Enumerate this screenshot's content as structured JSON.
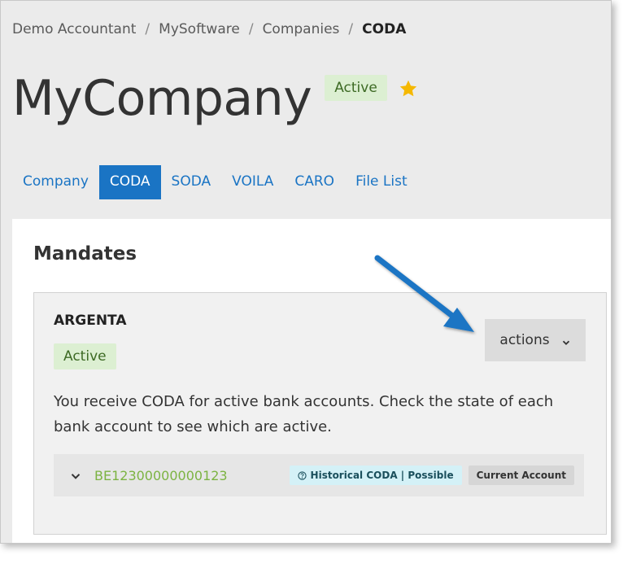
{
  "breadcrumb": {
    "items": [
      "Demo Accountant",
      "MySoftware",
      "Companies"
    ],
    "current": "CODA",
    "separator": "/"
  },
  "page": {
    "title": "MyCompany",
    "status": "Active",
    "favorite_icon": "star-icon"
  },
  "tabs": [
    {
      "label": "Company",
      "active": false
    },
    {
      "label": "CODA",
      "active": true
    },
    {
      "label": "SODA",
      "active": false
    },
    {
      "label": "VOILA",
      "active": false
    },
    {
      "label": "CARO",
      "active": false
    },
    {
      "label": "File List",
      "active": false
    }
  ],
  "mandates": {
    "title": "Mandates",
    "card": {
      "bank_name": "ARGENTA",
      "status": "Active",
      "actions_label": "actions",
      "description": "You receive CODA for active bank accounts. Check the state of each bank account to see which are active.",
      "account": {
        "iban": "BE12300000000123",
        "historical_tag": "Historical CODA | Possible",
        "account_type": "Current Account"
      }
    }
  },
  "colors": {
    "primary": "#1a74c4",
    "active_badge_bg": "#dcefd2",
    "active_badge_text": "#3d6a24",
    "iban_text": "#7cb342",
    "historical_tag_bg": "#d4f1f7",
    "star": "#f5b800",
    "annotation_arrow": "#1a74c4"
  }
}
